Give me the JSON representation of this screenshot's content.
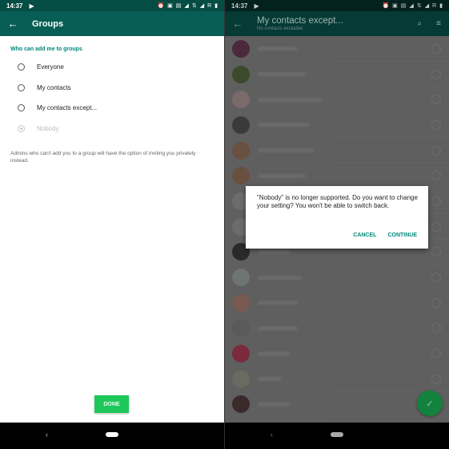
{
  "left": {
    "status": {
      "time": "14:37",
      "icons": [
        "alarm-icon",
        "vibrate-icon",
        "sim-icon",
        "signal-icon",
        "data-icon",
        "signal-icon",
        "roaming-label",
        "battery-icon"
      ],
      "roaming": "R"
    },
    "toolbar": {
      "title": "Groups"
    },
    "section_title": "Who can add me to groups",
    "options": [
      {
        "label": "Everyone",
        "checked": false,
        "disabled": false
      },
      {
        "label": "My contacts",
        "checked": false,
        "disabled": false
      },
      {
        "label": "My contacts except...",
        "checked": false,
        "disabled": false
      },
      {
        "label": "Nobody",
        "checked": true,
        "disabled": true
      }
    ],
    "note": "Admins who can't add you to a group will have the option of inviting you privately instead.",
    "done_label": "DONE"
  },
  "right": {
    "status": {
      "time": "14:37",
      "roaming": "R"
    },
    "toolbar": {
      "title": "My contacts except...",
      "subtitle": "No contacts excluded"
    },
    "contacts_count_visible": 15,
    "avatar_colors": [
      "#4a2a3a",
      "#3a4a2a",
      "#7a6a6a",
      "#3a3a3a",
      "#6a5040",
      "#6a5040",
      "#6c6c6c",
      "#6c6c6c",
      "#2a2a2a",
      "#6e7474",
      "#7a5a50",
      "#5a5a5a",
      "#7a2a3a",
      "#6a6a60",
      "#3a2a2a"
    ],
    "dialog": {
      "message": "\"Nobody\" is no longer supported. Do you want to change your setting? You won't be able to switch back.",
      "cancel_label": "CANCEL",
      "continue_label": "CONTINUE"
    },
    "fab_icon": "check-icon"
  }
}
